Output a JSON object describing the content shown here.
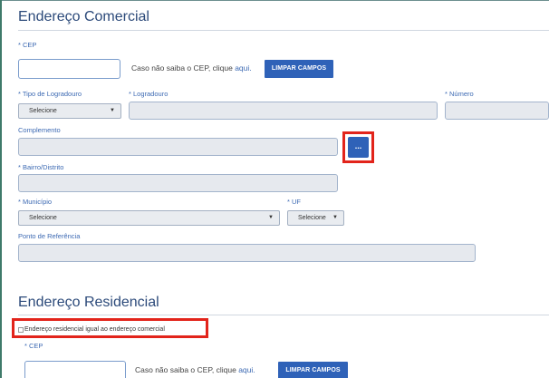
{
  "commercial": {
    "title": "Endereço Comercial",
    "cep_label": "* CEP",
    "cep_value": "",
    "cep_hint_text": "Caso não saiba o CEP, clique ",
    "cep_hint_link": "aqui.",
    "clear_button": "LIMPAR CAMPOS",
    "tipo_label": "* Tipo de Logradouro",
    "tipo_selected": "Selecione",
    "logradouro_label": "* Logradouro",
    "logradouro_value": "",
    "numero_label": "* Número",
    "numero_value": "",
    "complemento_label": "Complemento",
    "complemento_value": "",
    "dots_button": "...",
    "bairro_label": "* Bairro/Distrito",
    "bairro_value": "",
    "municipio_label": "* Município",
    "municipio_selected": "Selecione",
    "uf_label": "* UF",
    "uf_selected": "Selecione",
    "referencia_label": "Ponto de Referência",
    "referencia_value": ""
  },
  "residential": {
    "title": "Endereço Residencial",
    "same_address_label": "Endereço residencial igual ao endereço comercial",
    "same_address_checked": false,
    "cep_label": "* CEP",
    "cep_value": "",
    "cep_hint_text": "Caso não saiba o CEP, clique ",
    "cep_hint_link": "aqui.",
    "clear_button": "LIMPAR CAMPOS"
  },
  "icons": {
    "select_arrow": "▼"
  },
  "colors": {
    "accent": "#2f62b8",
    "highlight": "#e2241b",
    "title": "#2c4a7a",
    "label": "#3d6ab3"
  }
}
